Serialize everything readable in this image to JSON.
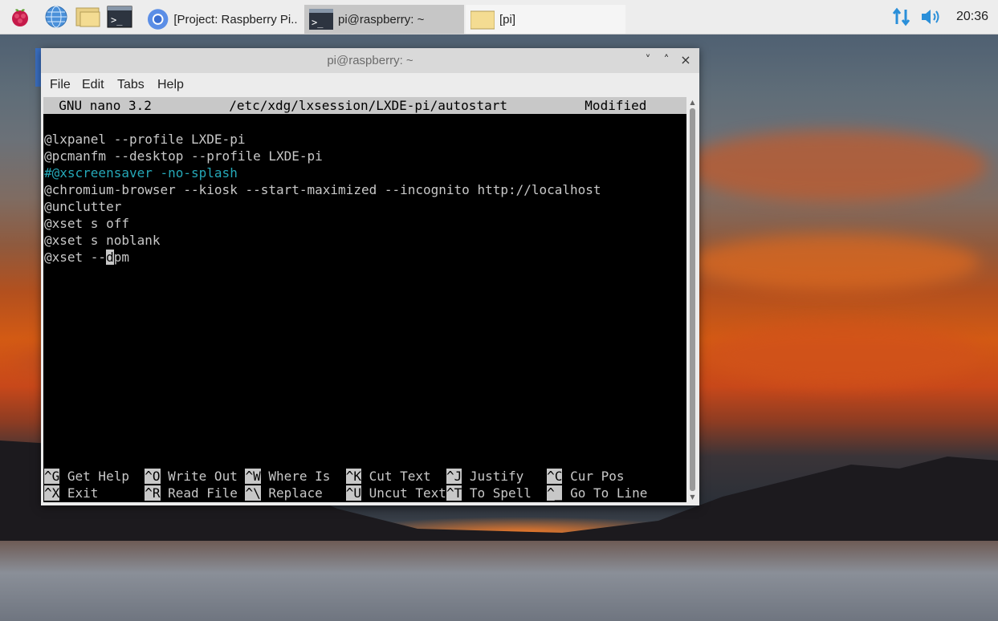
{
  "taskbar": {
    "launchers": [
      {
        "name": "raspberry-menu-icon"
      },
      {
        "name": "web-browser-icon"
      },
      {
        "name": "file-manager-icon"
      },
      {
        "name": "terminal-icon"
      }
    ],
    "tasks": [
      {
        "label": "[Project: Raspberry Pi...",
        "icon": "chromium-icon",
        "active": false
      },
      {
        "label": "pi@raspberry: ~",
        "icon": "terminal-icon",
        "active": true
      },
      {
        "label": "[pi]",
        "icon": "folder-icon",
        "active": false
      }
    ],
    "tray": {
      "network_icon": "network-arrows-icon",
      "volume_icon": "speaker-icon"
    },
    "clock": "20:36"
  },
  "window": {
    "title": "pi@raspberry: ~",
    "controls": {
      "minimize": "˅",
      "maximize": "˄",
      "close": "×"
    },
    "menu": [
      "File",
      "Edit",
      "Tabs",
      "Help"
    ]
  },
  "nano": {
    "header": "  GNU nano 3.2          /etc/xdg/lxsession/LXDE-pi/autostart          Modified  ",
    "lines": [
      {
        "text": "@lxpanel --profile LXDE-pi",
        "type": "normal"
      },
      {
        "text": "@pcmanfm --desktop --profile LXDE-pi",
        "type": "normal"
      },
      {
        "text": "#@xscreensaver -no-splash",
        "type": "comment"
      },
      {
        "text": "@chromium-browser --kiosk --start-maximized --incognito http://localhost",
        "type": "normal"
      },
      {
        "text": "@unclutter",
        "type": "normal"
      },
      {
        "text": "@xset s off",
        "type": "normal"
      },
      {
        "text": "@xset s noblank",
        "type": "normal"
      }
    ],
    "cursor_line": {
      "before": "@xset --",
      "cursor_char": "d",
      "after": "pm"
    },
    "shortcuts_row1": [
      {
        "key": "^G",
        "label": " Get Help  "
      },
      {
        "key": "^O",
        "label": " Write Out "
      },
      {
        "key": "^W",
        "label": " Where Is  "
      },
      {
        "key": "^K",
        "label": " Cut Text  "
      },
      {
        "key": "^J",
        "label": " Justify   "
      },
      {
        "key": "^C",
        "label": " Cur Pos"
      }
    ],
    "shortcuts_row2": [
      {
        "key": "^X",
        "label": " Exit      "
      },
      {
        "key": "^R",
        "label": " Read File "
      },
      {
        "key": "^\\",
        "label": " Replace   "
      },
      {
        "key": "^U",
        "label": " Uncut Text"
      },
      {
        "key": "^T",
        "label": " To Spell  "
      },
      {
        "key": "^_",
        "label": " Go To Line"
      }
    ]
  },
  "colors": {
    "comment": "#25a8b8",
    "terminal_fg": "#c8c8c8",
    "terminal_bg": "#000000",
    "taskbar_bg": "#ededed"
  }
}
